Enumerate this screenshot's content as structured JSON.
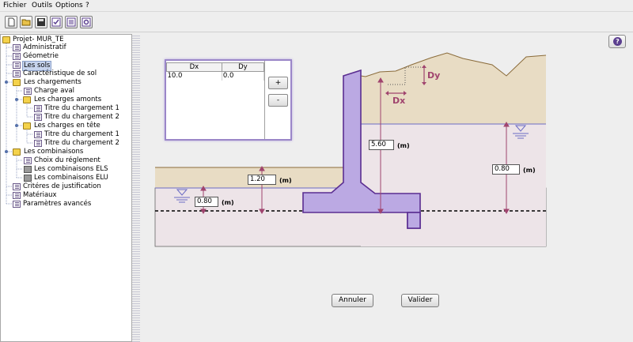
{
  "menubar": {
    "items": [
      "Fichier",
      "Outils",
      "Options",
      "?"
    ]
  },
  "toolbar": {
    "buttons": [
      "new-file-icon",
      "open-folder-icon",
      "save-icon",
      "check-icon",
      "list-icon",
      "settings-icon"
    ]
  },
  "tree": {
    "root": "Projet- MUR_TE",
    "items": {
      "administratif": "Administratif",
      "geometrie": "Géometrie",
      "les_sols": "Les sols",
      "caracteristique": "Caractéristique de sol",
      "chargements": "Les chargements",
      "charge_aval": "Charge aval",
      "charges_amonts": "Les charges amonts",
      "titre1a": "Titre du chargement 1",
      "titre2a": "Titre du chargement 2",
      "charges_tete": "Les charges en tête",
      "titre1b": "Titre du chargement 1",
      "titre2b": "Titre du chargement 2",
      "combinaisons": "Les combinaisons",
      "choix": "Choix du réglement",
      "els": "Les combinaisons ELS",
      "elu": "Les combinaisons ELU",
      "criteres": "Critéres de justification",
      "materiaux": "Matériaux",
      "parametres": "Paramètres avancés"
    }
  },
  "table": {
    "headers": [
      "Dx",
      "Dy"
    ],
    "rows": [
      [
        "10.0",
        "0.0"
      ]
    ]
  },
  "buttons": {
    "add": "+",
    "remove": "-",
    "cancel": "Annuler",
    "validate": "Valider"
  },
  "diagram": {
    "labels": {
      "dx": "Dx",
      "dy": "Dy"
    },
    "dims": {
      "height_wall": "5.60",
      "fill_front": "1.20",
      "water_front": "0.80",
      "water_back": "0.80"
    },
    "unit": "(m)"
  },
  "colors": {
    "soil": "#e8dcc4",
    "ground": "#ede4e8",
    "wall": "#bba9e3",
    "wall_stroke": "#5a2d91",
    "dim": "#a0446e",
    "water": "#6b6bc4"
  }
}
